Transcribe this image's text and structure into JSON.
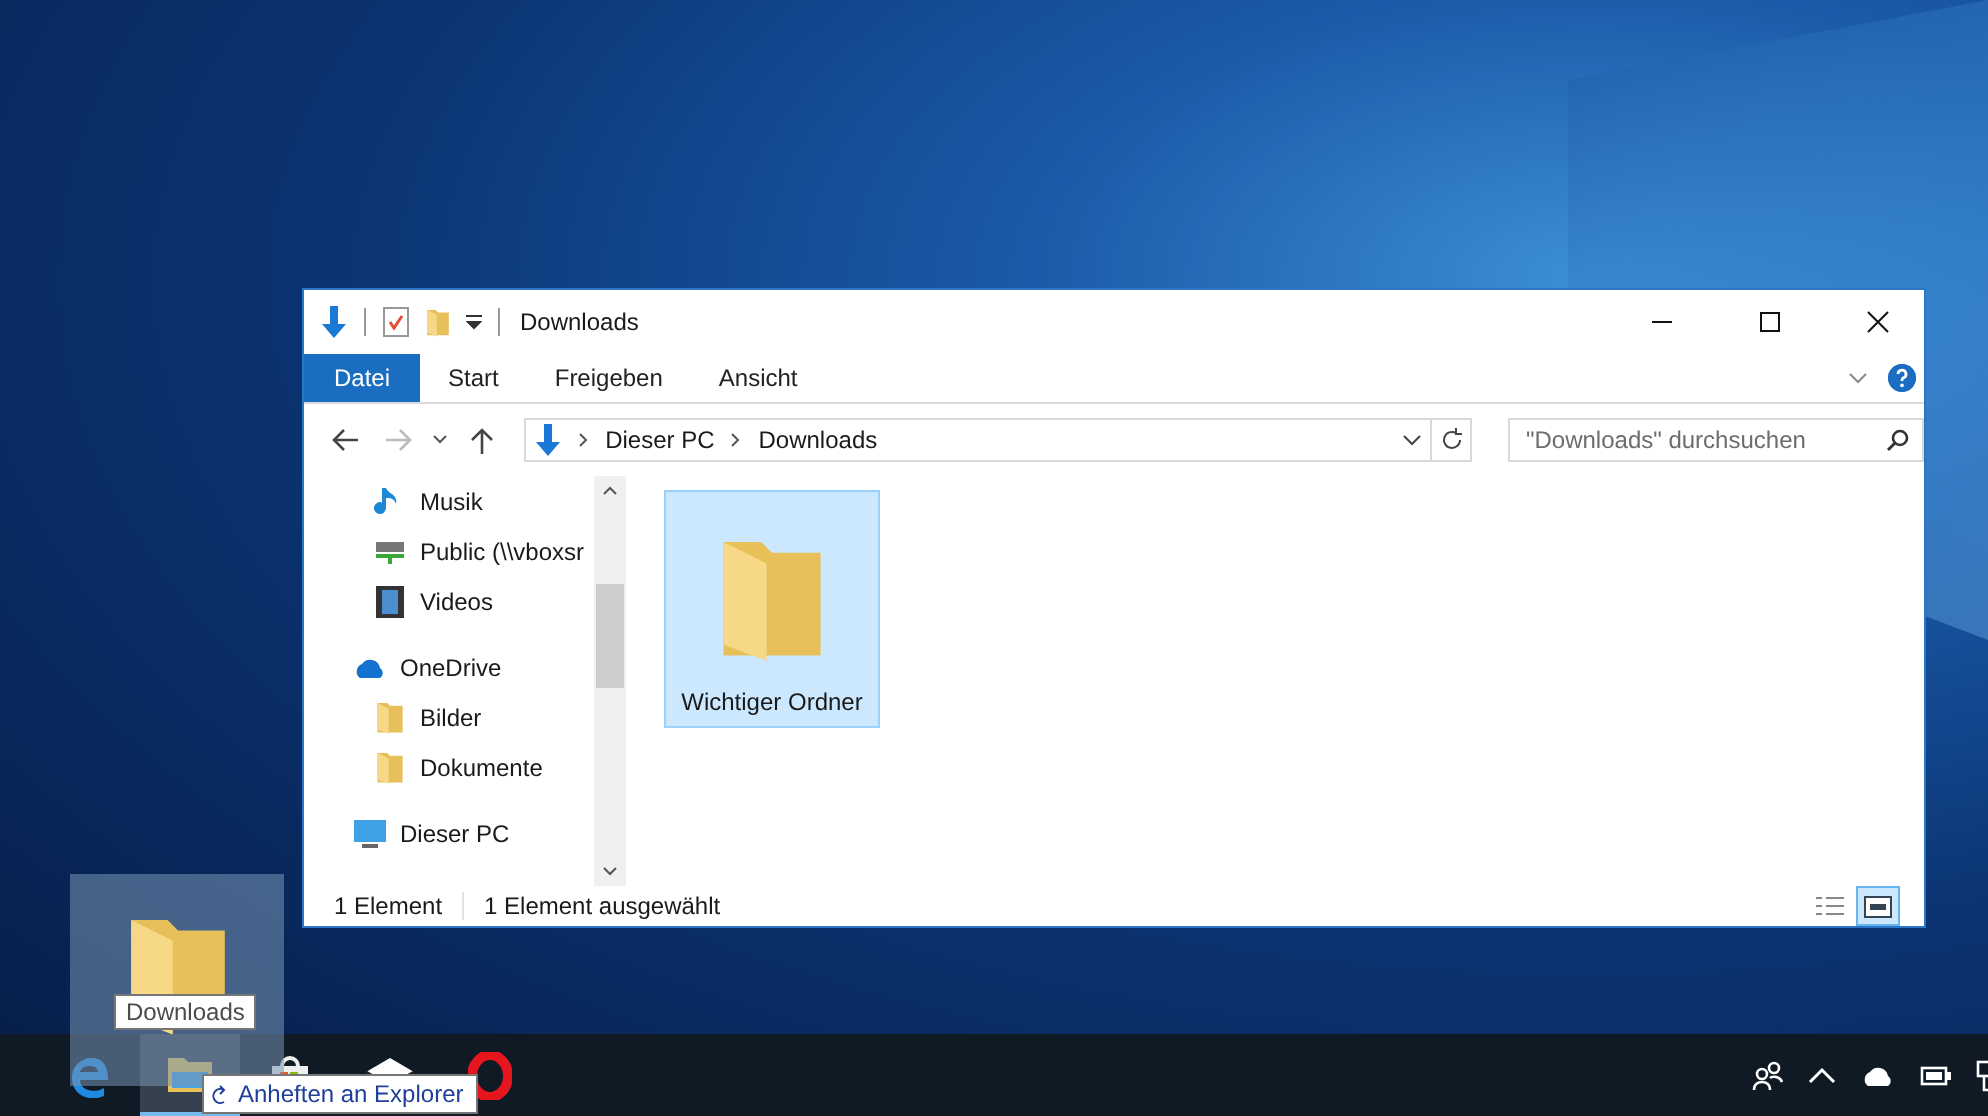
{
  "window": {
    "title": "Downloads",
    "controls": [
      {
        "kind": "minimize"
      },
      {
        "kind": "maximize"
      },
      {
        "kind": "close"
      }
    ],
    "ribbon_tabs": [
      {
        "label": "Datei",
        "selected": true
      },
      {
        "label": "Start",
        "selected": false
      },
      {
        "label": "Freigeben",
        "selected": false
      },
      {
        "label": "Ansicht",
        "selected": false
      }
    ],
    "address": {
      "segments": [
        "Dieser PC",
        "Downloads"
      ]
    },
    "search": {
      "placeholder": "\"Downloads\" durchsuchen"
    },
    "nav_pane": {
      "items": [
        {
          "children": [
            {
              "label": "Musik",
              "kind": "music"
            },
            {
              "label": "Public (\\\\vboxsr",
              "kind": "network"
            },
            {
              "label": "Videos",
              "kind": "video"
            }
          ]
        },
        {
          "label": "OneDrive",
          "kind": "cloud",
          "children": [
            {
              "label": "Bilder",
              "kind": "folder"
            },
            {
              "label": "Dokumente",
              "kind": "folder"
            }
          ]
        },
        {
          "label": "Dieser PC",
          "kind": "pc"
        }
      ]
    },
    "items": [
      {
        "name": "Wichtiger Ordner",
        "selected": true
      }
    ],
    "status_bar": {
      "count": "1 Element",
      "selection": "1 Element ausgewählt"
    },
    "view_buttons": [
      {
        "kind": "details",
        "selected": false
      },
      {
        "kind": "large_icons",
        "selected": true
      }
    ]
  },
  "drag_preview": {
    "label": "Downloads"
  },
  "taskbar": {
    "apps": [
      {
        "kind": "edge",
        "active": false
      },
      {
        "kind": "explorer",
        "active": true
      },
      {
        "kind": "store",
        "active": false
      },
      {
        "kind": "mail",
        "active": false
      },
      {
        "kind": "opera",
        "active": false
      }
    ],
    "tooltip": "Anheften an Explorer",
    "tray": [
      {
        "kind": "people"
      },
      {
        "kind": "chevron"
      },
      {
        "kind": "cloud"
      },
      {
        "kind": "battery"
      },
      {
        "kind": "network"
      }
    ]
  }
}
